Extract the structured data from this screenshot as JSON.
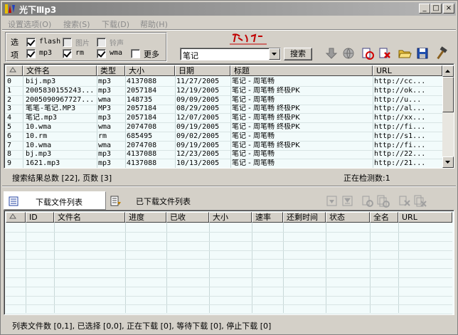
{
  "window": {
    "title": "光下Ⅲp3",
    "minimize": "_",
    "maximize": "□",
    "close": "×"
  },
  "menu": [
    "设置选项(O)",
    "搜索(S)",
    "下载(D)",
    "帮助(H)"
  ],
  "options": {
    "label_top": "选",
    "label_bottom": "项",
    "items": [
      {
        "label": "flash",
        "checked": true,
        "enabled": true
      },
      {
        "label": "图片",
        "checked": false,
        "enabled": false
      },
      {
        "label": "铃声",
        "checked": false,
        "enabled": false
      },
      {
        "label": "mp3",
        "checked": true,
        "enabled": true
      },
      {
        "label": "rm",
        "checked": true,
        "enabled": true
      },
      {
        "label": "wma",
        "checked": true,
        "enabled": true
      },
      {
        "label": "更多",
        "checked": false,
        "enabled": true
      }
    ]
  },
  "search": {
    "query": "笔记",
    "button": "搜索"
  },
  "results": {
    "columns": [
      "",
      "文件名",
      "类型",
      "大小",
      "日期",
      "标题",
      "URL"
    ],
    "rows": [
      [
        "0",
        "bij.mp3",
        "mp3",
        "4137088",
        "11/27/2005",
        "笔记 - 周笔畅",
        "http://cc..."
      ],
      [
        "1",
        "2005830155243...",
        "mp3",
        "2057184",
        "12/19/2005",
        "笔记 - 周笔畅 终极PK",
        "http://ok..."
      ],
      [
        "2",
        "2005090967727...",
        "wma",
        "148735",
        "09/09/2005",
        "笔记 - 周笔畅",
        "http://u..."
      ],
      [
        "3",
        "笔笔-笔记.MP3",
        "MP3",
        "2057184",
        "08/29/2005",
        "笔记 - 周笔畅 终极PK",
        "http://al..."
      ],
      [
        "4",
        "笔记.mp3",
        "mp3",
        "2057184",
        "12/07/2005",
        "笔记 - 周笔畅 终极PK",
        "http://xx..."
      ],
      [
        "5",
        "10.wma",
        "wma",
        "2074708",
        "09/19/2005",
        "笔记 - 周笔畅 终极PK",
        "http://fi..."
      ],
      [
        "6",
        "10.rm",
        "rm",
        "685495",
        "09/02/2005",
        "笔记 - 周笔畅",
        "http://s1..."
      ],
      [
        "7",
        "10.wma",
        "wma",
        "2074708",
        "09/19/2005",
        "笔记 - 周笔畅 终极PK",
        "http://fi..."
      ],
      [
        "8",
        "bj.mp3",
        "mp3",
        "4137088",
        "12/23/2005",
        "笔记 - 周笔畅",
        "http://22..."
      ],
      [
        "9",
        "1621.mp3",
        "mp3",
        "4137088",
        "10/13/2005",
        "笔记 - 周笔畅",
        "http://21..."
      ]
    ],
    "summary": "搜索结果总数 [22], 页数 [3]",
    "detecting": "正在检测数:1"
  },
  "tabs": {
    "download_list": "下载文件列表",
    "downloaded_list": "已下载文件列表"
  },
  "downloads": {
    "columns": [
      "",
      "ID",
      "文件名",
      "进度",
      "已收",
      "大小",
      "速率",
      "还剩时间",
      "状态",
      "全名",
      "URL"
    ],
    "rows": []
  },
  "statusbar": "列表文件数 [0,1], 已选择 [0,0], 正在下载 [0], 等待下载 [0], 停止下载 [0]",
  "colors": {
    "list_bg": "#f2fbfb",
    "face": "#d4d0c8",
    "logo_red": "#c00000"
  }
}
